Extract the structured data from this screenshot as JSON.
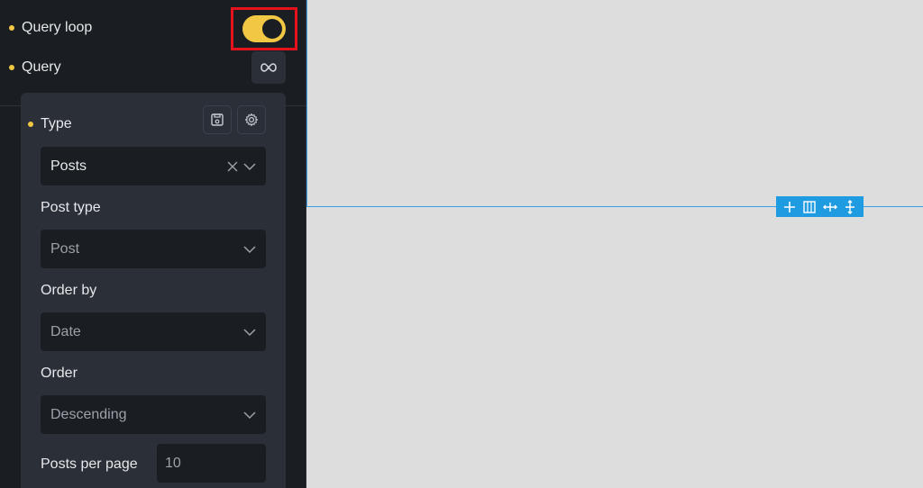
{
  "sidebar": {
    "query_loop_label": "Query loop",
    "query_label": "Query",
    "query_loop_enabled": true
  },
  "panel": {
    "type_label": "Type",
    "type_value": "Posts",
    "post_type_label": "Post type",
    "post_type_value": "Post",
    "order_by_label": "Order by",
    "order_by_value": "Date",
    "order_label": "Order",
    "order_value": "Descending",
    "posts_per_page_label": "Posts per page",
    "posts_per_page_placeholder": "10"
  },
  "colors": {
    "accent": "#f2c744",
    "highlight": "#e8121c",
    "canvas_line": "#3aa0e6",
    "toolbar": "#1f9be2"
  },
  "icons": {
    "query": "infinity-icon",
    "save": "save-template-icon",
    "settings": "gear-icon",
    "clear": "close-icon",
    "dropdown": "chevron-down-icon",
    "toolbar": [
      "plus-icon",
      "columns-icon",
      "move-horizontal-icon",
      "move-vertical-icon"
    ]
  }
}
